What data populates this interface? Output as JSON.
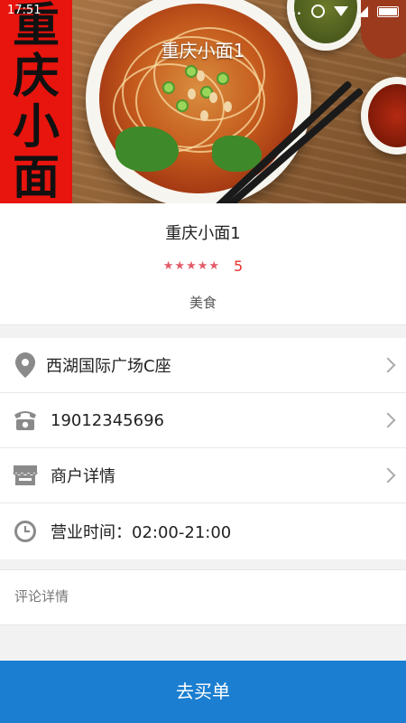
{
  "status_bar": {
    "time": "17:51",
    "dots": "..."
  },
  "hero": {
    "banner_chars": [
      "重",
      "庆",
      "小",
      "面"
    ],
    "title": "重庆小面1"
  },
  "shop": {
    "name": "重庆小面1",
    "star_count": 5,
    "rating": "5",
    "category": "美食"
  },
  "details": {
    "address": "西湖国际广场C座",
    "phone": "19012345696",
    "merchant_details": "商户详情",
    "hours": "营业时间：02:00-21:00"
  },
  "comments": {
    "label": "评论详情"
  },
  "checkout": {
    "label": "去买单"
  },
  "colors": {
    "accent": "#1b7ed0",
    "rating": "#e5302b",
    "stars": "#e35b6a"
  }
}
